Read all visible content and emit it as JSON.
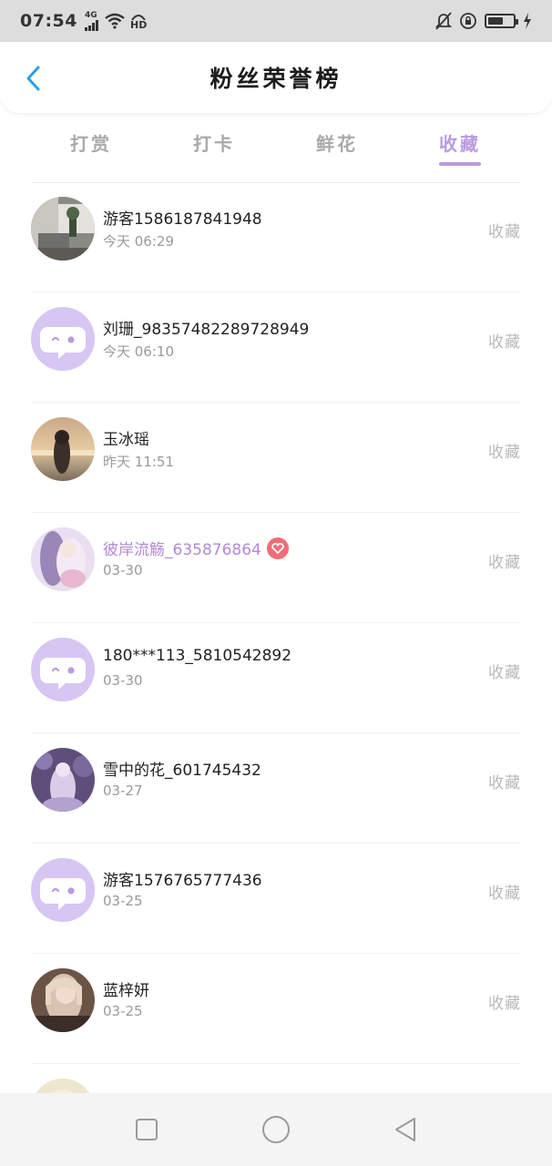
{
  "status_bar": {
    "time": "07:54",
    "network": "4G",
    "hd": "HD"
  },
  "header": {
    "title": "粉丝荣誉榜"
  },
  "tabs": [
    {
      "label": "打赏",
      "active": false
    },
    {
      "label": "打卡",
      "active": false
    },
    {
      "label": "鲜花",
      "active": false
    },
    {
      "label": "收藏",
      "active": true
    }
  ],
  "fans": [
    {
      "name": "游客1586187841948",
      "time": "今天 06:29",
      "action": "收藏",
      "avatar": "photo-room"
    },
    {
      "name": "刘珊_98357482289728949",
      "time": "今天 06:10",
      "action": "收藏",
      "avatar": "default-chat"
    },
    {
      "name": "玉冰瑶",
      "time": "昨天 11:51",
      "action": "收藏",
      "avatar": "photo-sunset"
    },
    {
      "name": "彼岸流觞_635876864",
      "time": "03-30",
      "action": "收藏",
      "avatar": "photo-anime",
      "highlight": true,
      "badge": "vip-heart-badge"
    },
    {
      "name": "180***113_5810542892",
      "time": "03-30",
      "action": "收藏",
      "avatar": "default-chat"
    },
    {
      "name": "雪中的花_601745432",
      "time": "03-27",
      "action": "收藏",
      "avatar": "photo-anime-purple"
    },
    {
      "name": "游客1576765777436",
      "time": "03-25",
      "action": "收藏",
      "avatar": "default-chat"
    },
    {
      "name": "蓝梓妍",
      "time": "03-25",
      "action": "收藏",
      "avatar": "photo-portrait"
    }
  ],
  "colors": {
    "accent": "#b89be0",
    "default_avatar_bg": "#d7c6f2",
    "inactive_tab": "#a9a9a9",
    "action_text": "#b8b8b8",
    "back_arrow": "#2aa0e6",
    "vip_badge": "#ef6d77"
  },
  "nav_bar": {
    "buttons": [
      "recent-apps-icon",
      "home-icon",
      "back-triangle-icon"
    ]
  }
}
